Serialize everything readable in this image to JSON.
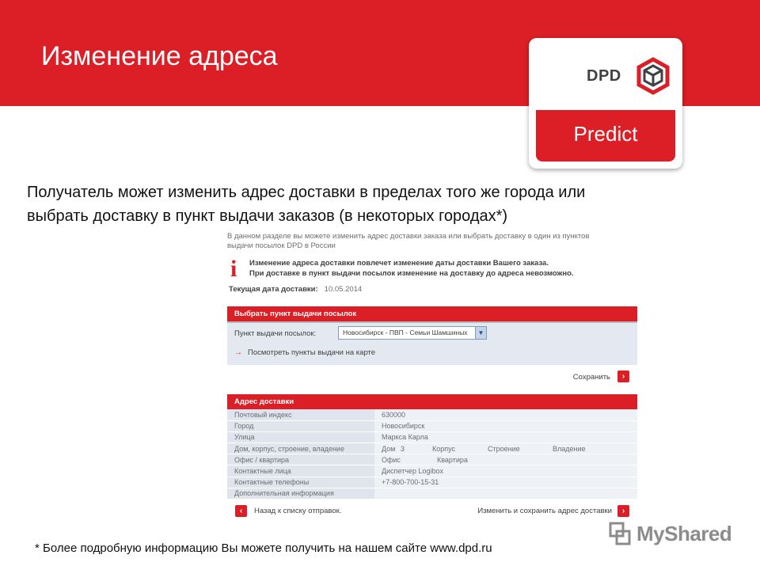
{
  "slide": {
    "title": "Изменение адреса",
    "intro_line1": "Получатель может изменить адрес доставки в пределах того же города или",
    "intro_line2": "выбрать доставку в пункт выдачи заказов (в некоторых городах*)",
    "footnote": "* Более подробную информацию Вы можете получить на нашем сайте www.dpd.ru",
    "accent_color": "#dc1e26"
  },
  "logo": {
    "brand": "DPD",
    "product": "Predict",
    "icon": "dpd-cube-icon"
  },
  "form": {
    "intro_line1": "В данном разделе вы можете изменить адрес доставки заказа или выбрать доставку в один из пунктов",
    "intro_line2": "выдачи посылок DPD в России",
    "notice_line1": "Изменение адреса доставки повлечет изменение даты доставки Вашего заказа.",
    "notice_line2": "При доставке в пункт выдачи посылок изменение на доставку до адреса невозможно.",
    "current_date_label": "Текущая дата доставки:",
    "current_date_value": "10.05.2014",
    "pickup_panel": {
      "title": "Выбрать пункт выдачи посылок",
      "field_label": "Пункт выдачи посылок:",
      "selected": "Новосибирск - ПВП - Семьи Шамшиных",
      "map_link": "Посмотреть пункты выдачи на карте",
      "save_label": "Сохранить"
    },
    "address_panel": {
      "title": "Адрес доставки",
      "rows": [
        {
          "label": "Почтовый индекс",
          "value": "630000"
        },
        {
          "label": "Город",
          "value": "Новосибирск"
        },
        {
          "label": "Улица",
          "value": "Маркса Карла"
        },
        {
          "label": "Дом, корпус, строение, владение",
          "value": ""
        },
        {
          "label": "Офис / квартира",
          "value": ""
        },
        {
          "label": "Контактные лица",
          "value": "Диспетчер Logibox"
        },
        {
          "label": "Контактные телефоны",
          "value": "+7-800-700-15-31"
        },
        {
          "label": "Дополнительная информация",
          "value": ""
        }
      ],
      "house": {
        "dom_label": "Дом",
        "dom_value": "3",
        "korpus_label": "Корпус",
        "stroenie_label": "Строение",
        "vladenie_label": "Владение"
      },
      "office": {
        "office_label": "Офис",
        "kvartira_label": "Квартира"
      }
    },
    "back_label": "Назад к списку отправок.",
    "change_save_label": "Изменить и сохранить адрес доставки"
  },
  "watermark": {
    "text": "MyShared",
    "icon": "myshared-logo-icon"
  }
}
